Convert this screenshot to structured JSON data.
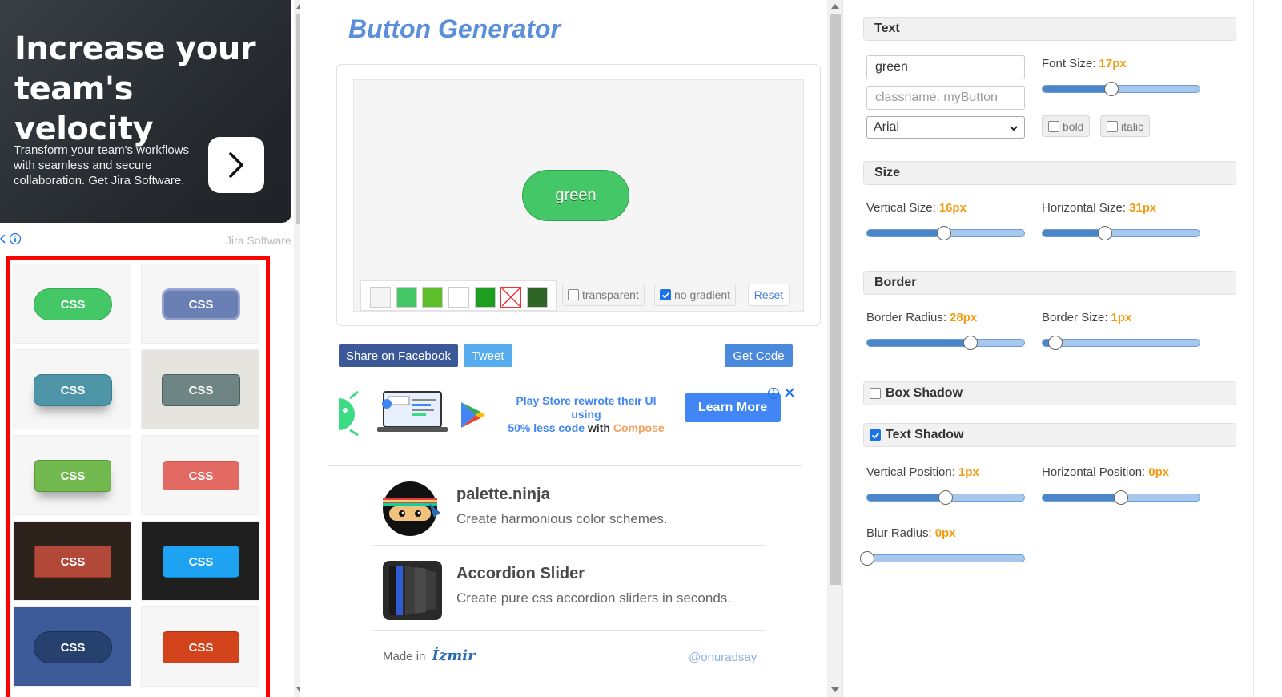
{
  "ad": {
    "headline": "Increase your team's velocity",
    "body": "Transform your team's workflows with seamless and secure collaboration. Get Jira Software.",
    "brand": "Jira Software",
    "arrow_icon": "chevron-right-icon"
  },
  "gallery": {
    "button_label": "CSS",
    "cells": [
      {
        "bg": "#f6f6f6",
        "btn": "#44c767",
        "border": "#36a955",
        "radius": "pill"
      },
      {
        "bg": "#f6f6f6",
        "btn": "#6a7fb4",
        "border": "#9aa8e6",
        "radius": "round"
      },
      {
        "bg": "#f6f6f6",
        "btn": "#4e95a8",
        "border": "#3d7b8d",
        "radius": "round"
      },
      {
        "bg": "#e6e4df",
        "btn": "#6e8583",
        "border": "#4d6260",
        "radius": "small"
      },
      {
        "bg": "#f6f6f6",
        "btn": "#71b84e",
        "border": "#5a9b38",
        "radius": "small"
      },
      {
        "bg": "#f6f6f6",
        "btn": "#e26a63",
        "border": "#d25a53",
        "radius": "small"
      },
      {
        "bg": "#2d231c",
        "btn": "#b24837",
        "border": "#8e3526",
        "radius": "none"
      },
      {
        "bg": "#1f1f1f",
        "btn": "#1ea3f3",
        "border": "#0d84cc",
        "radius": "small"
      },
      {
        "bg": "#3d5a99",
        "btn": "#27416e",
        "border": "#1b2f52",
        "radius": "pill"
      },
      {
        "bg": "#f6f6f6",
        "btn": "#d3431b",
        "border": "#b13311",
        "radius": "small"
      }
    ]
  },
  "main": {
    "title": "Button Generator",
    "preview_button_text": "green",
    "swatches": [
      "#f4f4f4",
      "#44c767",
      "#5cbf2a",
      "#ffffff",
      "#1e9e1e",
      "none",
      "#2f6627"
    ],
    "transparent_label": "transparent",
    "no_gradient_label": "no gradient",
    "reset_label": "Reset",
    "share_facebook": "Share on Facebook",
    "tweet": "Tweet",
    "get_code": "Get Code"
  },
  "banner": {
    "text_part1": "Play Store rewrote their UI using",
    "text_part2": "50% less code",
    "text_part3": " with ",
    "text_part4": "Compose",
    "cta": "Learn More"
  },
  "promos": [
    {
      "title": "palette.ninja",
      "desc": "Create harmonious color schemes.",
      "icon": "ninja-icon"
    },
    {
      "title": "Accordion Slider",
      "desc": "Create pure css accordion sliders in seconds.",
      "icon": "accordion-icon"
    }
  ],
  "footer": {
    "made_in": "Made in",
    "city": "İzmir",
    "handle": "@onuradsay"
  },
  "panel": {
    "text_section": "Text",
    "text_value": "green",
    "classname_placeholder": "classname: myButton",
    "font_family": "Arial",
    "font_size_label": "Font Size:",
    "font_size_value": "17px",
    "font_size_level": 0.44,
    "bold_label": "bold",
    "italic_label": "italic",
    "size_section": "Size",
    "vertical_size_label": "Vertical Size:",
    "vertical_size_value": "16px",
    "vertical_size_level": 0.49,
    "horizontal_size_label": "Horizontal Size:",
    "horizontal_size_value": "31px",
    "horizontal_size_level": 0.4,
    "border_section": "Border",
    "border_radius_label": "Border Radius:",
    "border_radius_value": "28px",
    "border_radius_level": 0.66,
    "border_size_label": "Border Size:",
    "border_size_value": "1px",
    "border_size_level": 0.08,
    "box_shadow_label": "Box Shadow",
    "text_shadow_label": "Text Shadow",
    "vpos_label": "Vertical Position:",
    "vpos_value": "1px",
    "vpos_level": 0.5,
    "hpos_label": "Horizontal Position:",
    "hpos_value": "0px",
    "hpos_level": 0.5,
    "blur_label": "Blur Radius:",
    "blur_value": "0px",
    "blur_level": 0.0
  }
}
